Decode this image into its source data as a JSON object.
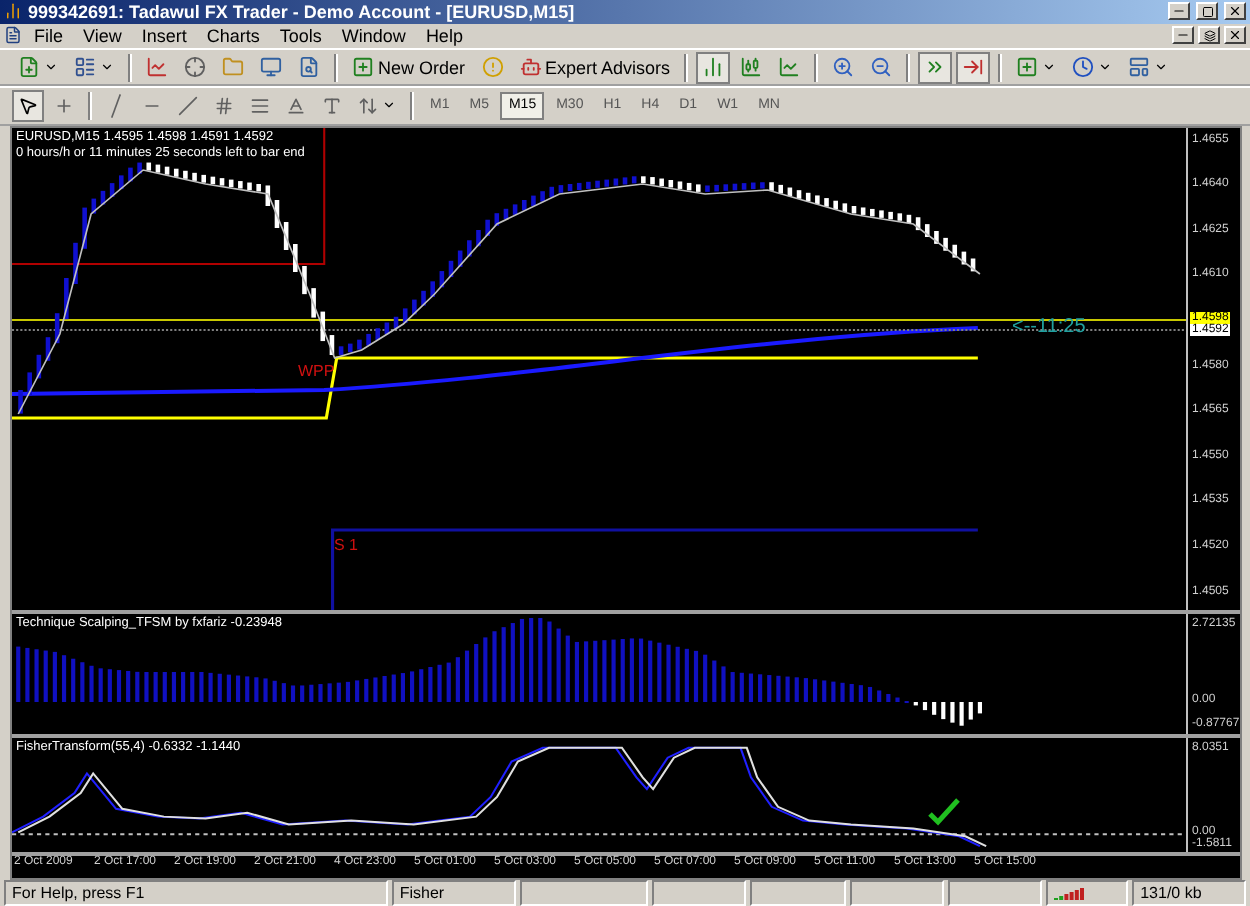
{
  "window": {
    "title": "999342691: Tadawul FX Trader - Demo Account - [EURUSD,M15]"
  },
  "menu": [
    "File",
    "View",
    "Insert",
    "Charts",
    "Tools",
    "Window",
    "Help"
  ],
  "toolbar": {
    "buttons": [
      "New Order",
      "Expert Advisors"
    ],
    "timeframes": [
      {
        "label": "M1",
        "selected": false
      },
      {
        "label": "M5",
        "selected": false
      },
      {
        "label": "M15",
        "selected": true
      },
      {
        "label": "M30",
        "selected": false
      },
      {
        "label": "H1",
        "selected": false
      },
      {
        "label": "H4",
        "selected": false
      },
      {
        "label": "D1",
        "selected": false
      },
      {
        "label": "W1",
        "selected": false
      },
      {
        "label": "MN",
        "selected": false
      }
    ]
  },
  "chart": {
    "symbol_line": "EURUSD,M15  1.4595 1.4598 1.4591 1.4592",
    "info_line": "0 hours/h or 11 minutes 25 seconds left to bar end",
    "price_axis": [
      "1.4655",
      "1.4640",
      "1.4625",
      "1.4610",
      "1.4580",
      "1.4565",
      "1.4550",
      "1.4535",
      "1.4520",
      "1.4505"
    ],
    "price_markers": [
      {
        "label": "1.4598",
        "kind": "ask"
      },
      {
        "label": "1.4592",
        "kind": "bid"
      }
    ],
    "levels": [
      "WPP",
      "S 1"
    ],
    "countdown": "<--11:25"
  },
  "indicators": [
    {
      "title": "Technique Scalping_TFSM by fxfariz -0.23948",
      "kind": "histogram",
      "axis": [
        "2.72135",
        "0.00",
        "-0.87767"
      ]
    },
    {
      "title": "FisherTransform(55,4) -0.6332 -1.1440",
      "kind": "lines",
      "axis": [
        "8.0351",
        "0.00",
        "-1.5811"
      ]
    }
  ],
  "time_axis": [
    "2 Oct 2009",
    "2 Oct 17:00",
    "2 Oct 19:00",
    "2 Oct 21:00",
    "4 Oct 23:00",
    "5 Oct 01:00",
    "5 Oct 03:00",
    "5 Oct 05:00",
    "5 Oct 07:00",
    "5 Oct 09:00",
    "5 Oct 11:00",
    "5 Oct 13:00",
    "5 Oct 15:00"
  ],
  "status_bar": {
    "sections": [
      "For Help, press F1",
      "Fisher"
    ],
    "traffic": "131/0 kb"
  }
}
